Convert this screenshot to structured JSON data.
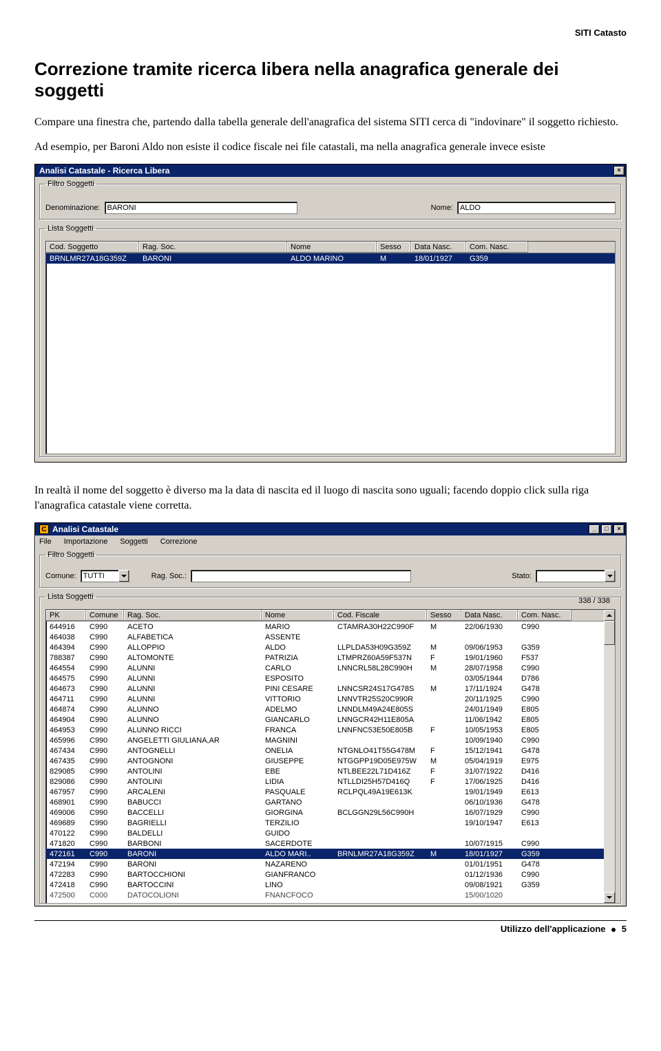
{
  "doc": {
    "header_right": "SITI Catasto",
    "heading": "Correzione tramite ricerca libera nella anagrafica generale dei soggetti",
    "para1": "Compare una finestra che, partendo dalla tabella generale dell'anagrafica del sistema SITI cerca di \"indovinare\" il soggetto richiesto.",
    "para2": "Ad esempio, per Baroni Aldo non esiste il codice fiscale nei file catastali, ma nella anagrafica generale invece esiste",
    "para3": "In realtà il nome del soggetto è diverso ma la data di nascita ed il luogo di nascita sono uguali; facendo doppio click sulla riga l'anagrafica catastale viene corretta.",
    "footer_section": "Utilizzo dell'applicazione",
    "footer_page": "5"
  },
  "win1": {
    "title": "Analisi Catastale - Ricerca Libera",
    "grp_filtro": "Filtro Soggetti",
    "lbl_denom": "Denominazione:",
    "val_denom": "BARONI",
    "lbl_nome": "Nome:",
    "val_nome": "ALDO",
    "grp_lista": "Lista Soggetti",
    "hdr": {
      "cs": "Cod. Soggetto",
      "rs": "Rag. Soc.",
      "nm": "Nome",
      "sx": "Sesso",
      "dn": "Data Nasc.",
      "cn": "Com. Nasc."
    },
    "rows": [
      {
        "cs": "BRNLMR27A18G359Z",
        "rs": "BARONI",
        "nm": "ALDO MARINO",
        "sx": "M",
        "dn": "18/01/1927",
        "cn": "G359"
      }
    ]
  },
  "win2": {
    "title": "Analisi Catastale",
    "menus": [
      "File",
      "Importazione",
      "Soggetti",
      "Correzione"
    ],
    "grp_filtro": "Filtro Soggetti",
    "lbl_comune": "Comune:",
    "val_comune": "TUTTI",
    "lbl_ragsoc": "Rag. Soc.:",
    "val_ragsoc": "",
    "lbl_stato": "Stato:",
    "val_stato": "",
    "grp_lista": "Lista Soggetti",
    "counter": "338 / 338",
    "hdr": {
      "pk": "PK",
      "cm": "Comune",
      "rs": "Rag. Soc.",
      "nm": "Nome",
      "cf": "Cod. Fiscale",
      "sx": "Sesso",
      "dn": "Data Nasc.",
      "cn": "Com. Nasc."
    },
    "rows": [
      {
        "pk": "644916",
        "cm": "C990",
        "rs": "ACETO",
        "nm": "MARIO",
        "cf": "CTAMRA30H22C990F",
        "sx": "M",
        "dn": "22/06/1930",
        "cn": "C990",
        "sel": false
      },
      {
        "pk": "464038",
        "cm": "C990",
        "rs": "ALFABETICA",
        "nm": "ASSENTE",
        "cf": "",
        "sx": "",
        "dn": "",
        "cn": "",
        "sel": false
      },
      {
        "pk": "464394",
        "cm": "C990",
        "rs": "ALLOPPIO",
        "nm": "ALDO",
        "cf": "LLPLDA53H09G359Z",
        "sx": "M",
        "dn": "09/06/1953",
        "cn": "G359",
        "sel": false
      },
      {
        "pk": "788387",
        "cm": "C990",
        "rs": "ALTOMONTE",
        "nm": "PATRIZIA",
        "cf": "LTMPRZ60A59F537N",
        "sx": "F",
        "dn": "19/01/1960",
        "cn": "F537",
        "sel": false
      },
      {
        "pk": "464554",
        "cm": "C990",
        "rs": "ALUNNI",
        "nm": "CARLO",
        "cf": "LNNCRL58L28C990H",
        "sx": "M",
        "dn": "28/07/1958",
        "cn": "C990",
        "sel": false
      },
      {
        "pk": "464575",
        "cm": "C990",
        "rs": "ALUNNI",
        "nm": "ESPOSITO",
        "cf": "",
        "sx": "",
        "dn": "03/05/1944",
        "cn": "D786",
        "sel": false
      },
      {
        "pk": "464673",
        "cm": "C990",
        "rs": "ALUNNI",
        "nm": "PINI CESARE",
        "cf": "LNNCSR24S17G478S",
        "sx": "M",
        "dn": "17/11/1924",
        "cn": "G478",
        "sel": false
      },
      {
        "pk": "464711",
        "cm": "C990",
        "rs": "ALUNNI",
        "nm": "VITTORIO",
        "cf": "LNNVTR25S20C990R",
        "sx": "",
        "dn": "20/11/1925",
        "cn": "C990",
        "sel": false
      },
      {
        "pk": "464874",
        "cm": "C990",
        "rs": "ALUNNO",
        "nm": "ADELMO",
        "cf": "LNNDLM49A24E805S",
        "sx": "",
        "dn": "24/01/1949",
        "cn": "E805",
        "sel": false
      },
      {
        "pk": "464904",
        "cm": "C990",
        "rs": "ALUNNO",
        "nm": "GIANCARLO",
        "cf": "LNNGCR42H11E805A",
        "sx": "",
        "dn": "11/06/1942",
        "cn": "E805",
        "sel": false
      },
      {
        "pk": "464953",
        "cm": "C990",
        "rs": "ALUNNO RICCI",
        "nm": "FRANCA",
        "cf": "LNNFNC53E50E805B",
        "sx": "F",
        "dn": "10/05/1953",
        "cn": "E805",
        "sel": false
      },
      {
        "pk": "465996",
        "cm": "C990",
        "rs": "ANGELETTI GIULIANA,AR",
        "nm": "MAGNINI",
        "cf": "",
        "sx": "",
        "dn": "10/09/1940",
        "cn": "C990",
        "sel": false
      },
      {
        "pk": "467434",
        "cm": "C990",
        "rs": "ANTOGNELLI",
        "nm": "ONELIA",
        "cf": "NTGNLO41T55G478M",
        "sx": "F",
        "dn": "15/12/1941",
        "cn": "G478",
        "sel": false
      },
      {
        "pk": "467435",
        "cm": "C990",
        "rs": "ANTOGNONI",
        "nm": "GIUSEPPE",
        "cf": "NTGGPP19D05E975W",
        "sx": "M",
        "dn": "05/04/1919",
        "cn": "E975",
        "sel": false
      },
      {
        "pk": "829085",
        "cm": "C990",
        "rs": "ANTOLINI",
        "nm": "EBE",
        "cf": "NTLBEE22L71D416Z",
        "sx": "F",
        "dn": "31/07/1922",
        "cn": "D416",
        "sel": false
      },
      {
        "pk": "829086",
        "cm": "C990",
        "rs": "ANTOLINI",
        "nm": "LIDIA",
        "cf": "NTLLDI25H57D416Q",
        "sx": "F",
        "dn": "17/06/1925",
        "cn": "D416",
        "sel": false
      },
      {
        "pk": "467957",
        "cm": "C990",
        "rs": "ARCALENI",
        "nm": "PASQUALE",
        "cf": "RCLPQL49A19E613K",
        "sx": "",
        "dn": "19/01/1949",
        "cn": "E613",
        "sel": false
      },
      {
        "pk": "468901",
        "cm": "C990",
        "rs": "BABUCCI",
        "nm": "GARTANO",
        "cf": "",
        "sx": "",
        "dn": "06/10/1936",
        "cn": "G478",
        "sel": false
      },
      {
        "pk": "469006",
        "cm": "C990",
        "rs": "BACCELLI",
        "nm": "GIORGINA",
        "cf": "BCLGGN29L56C990H",
        "sx": "",
        "dn": "16/07/1929",
        "cn": "C990",
        "sel": false
      },
      {
        "pk": "469689",
        "cm": "C990",
        "rs": "BAGRIELLI",
        "nm": "TERZILIO",
        "cf": "",
        "sx": "",
        "dn": "19/10/1947",
        "cn": "E613",
        "sel": false
      },
      {
        "pk": "470122",
        "cm": "C990",
        "rs": "BALDELLI",
        "nm": "GUIDO",
        "cf": "",
        "sx": "",
        "dn": "",
        "cn": "",
        "sel": false
      },
      {
        "pk": "471820",
        "cm": "C990",
        "rs": "BARBONI",
        "nm": "SACERDOTE",
        "cf": "",
        "sx": "",
        "dn": "10/07/1915",
        "cn": "C990",
        "sel": false
      },
      {
        "pk": "472161",
        "cm": "C990",
        "rs": "BARONI",
        "nm": "ALDO MARI..",
        "cf": "BRNLMR27A18G359Z",
        "sx": "M",
        "dn": "18/01/1927",
        "cn": "G359",
        "sel": true
      },
      {
        "pk": "472194",
        "cm": "C990",
        "rs": "BARONI",
        "nm": "NAZARENO",
        "cf": "",
        "sx": "",
        "dn": "01/01/1951",
        "cn": "G478",
        "sel": false
      },
      {
        "pk": "472283",
        "cm": "C990",
        "rs": "BARTOCCHIONI",
        "nm": "GIANFRANCO",
        "cf": "",
        "sx": "",
        "dn": "01/12/1936",
        "cn": "C990",
        "sel": false
      },
      {
        "pk": "472418",
        "cm": "C990",
        "rs": "BARTOCCINI",
        "nm": "LINO",
        "cf": "",
        "sx": "",
        "dn": "09/08/1921",
        "cn": "G359",
        "sel": false
      }
    ],
    "rows_partial": [
      {
        "pk": "472500",
        "cm": "C000",
        "rs": "DATOCOLIONI",
        "nm": "FNANCFOCO",
        "cf": "",
        "sx": "",
        "dn": "15/00/1020",
        "cn": "",
        "sel": false
      }
    ]
  }
}
